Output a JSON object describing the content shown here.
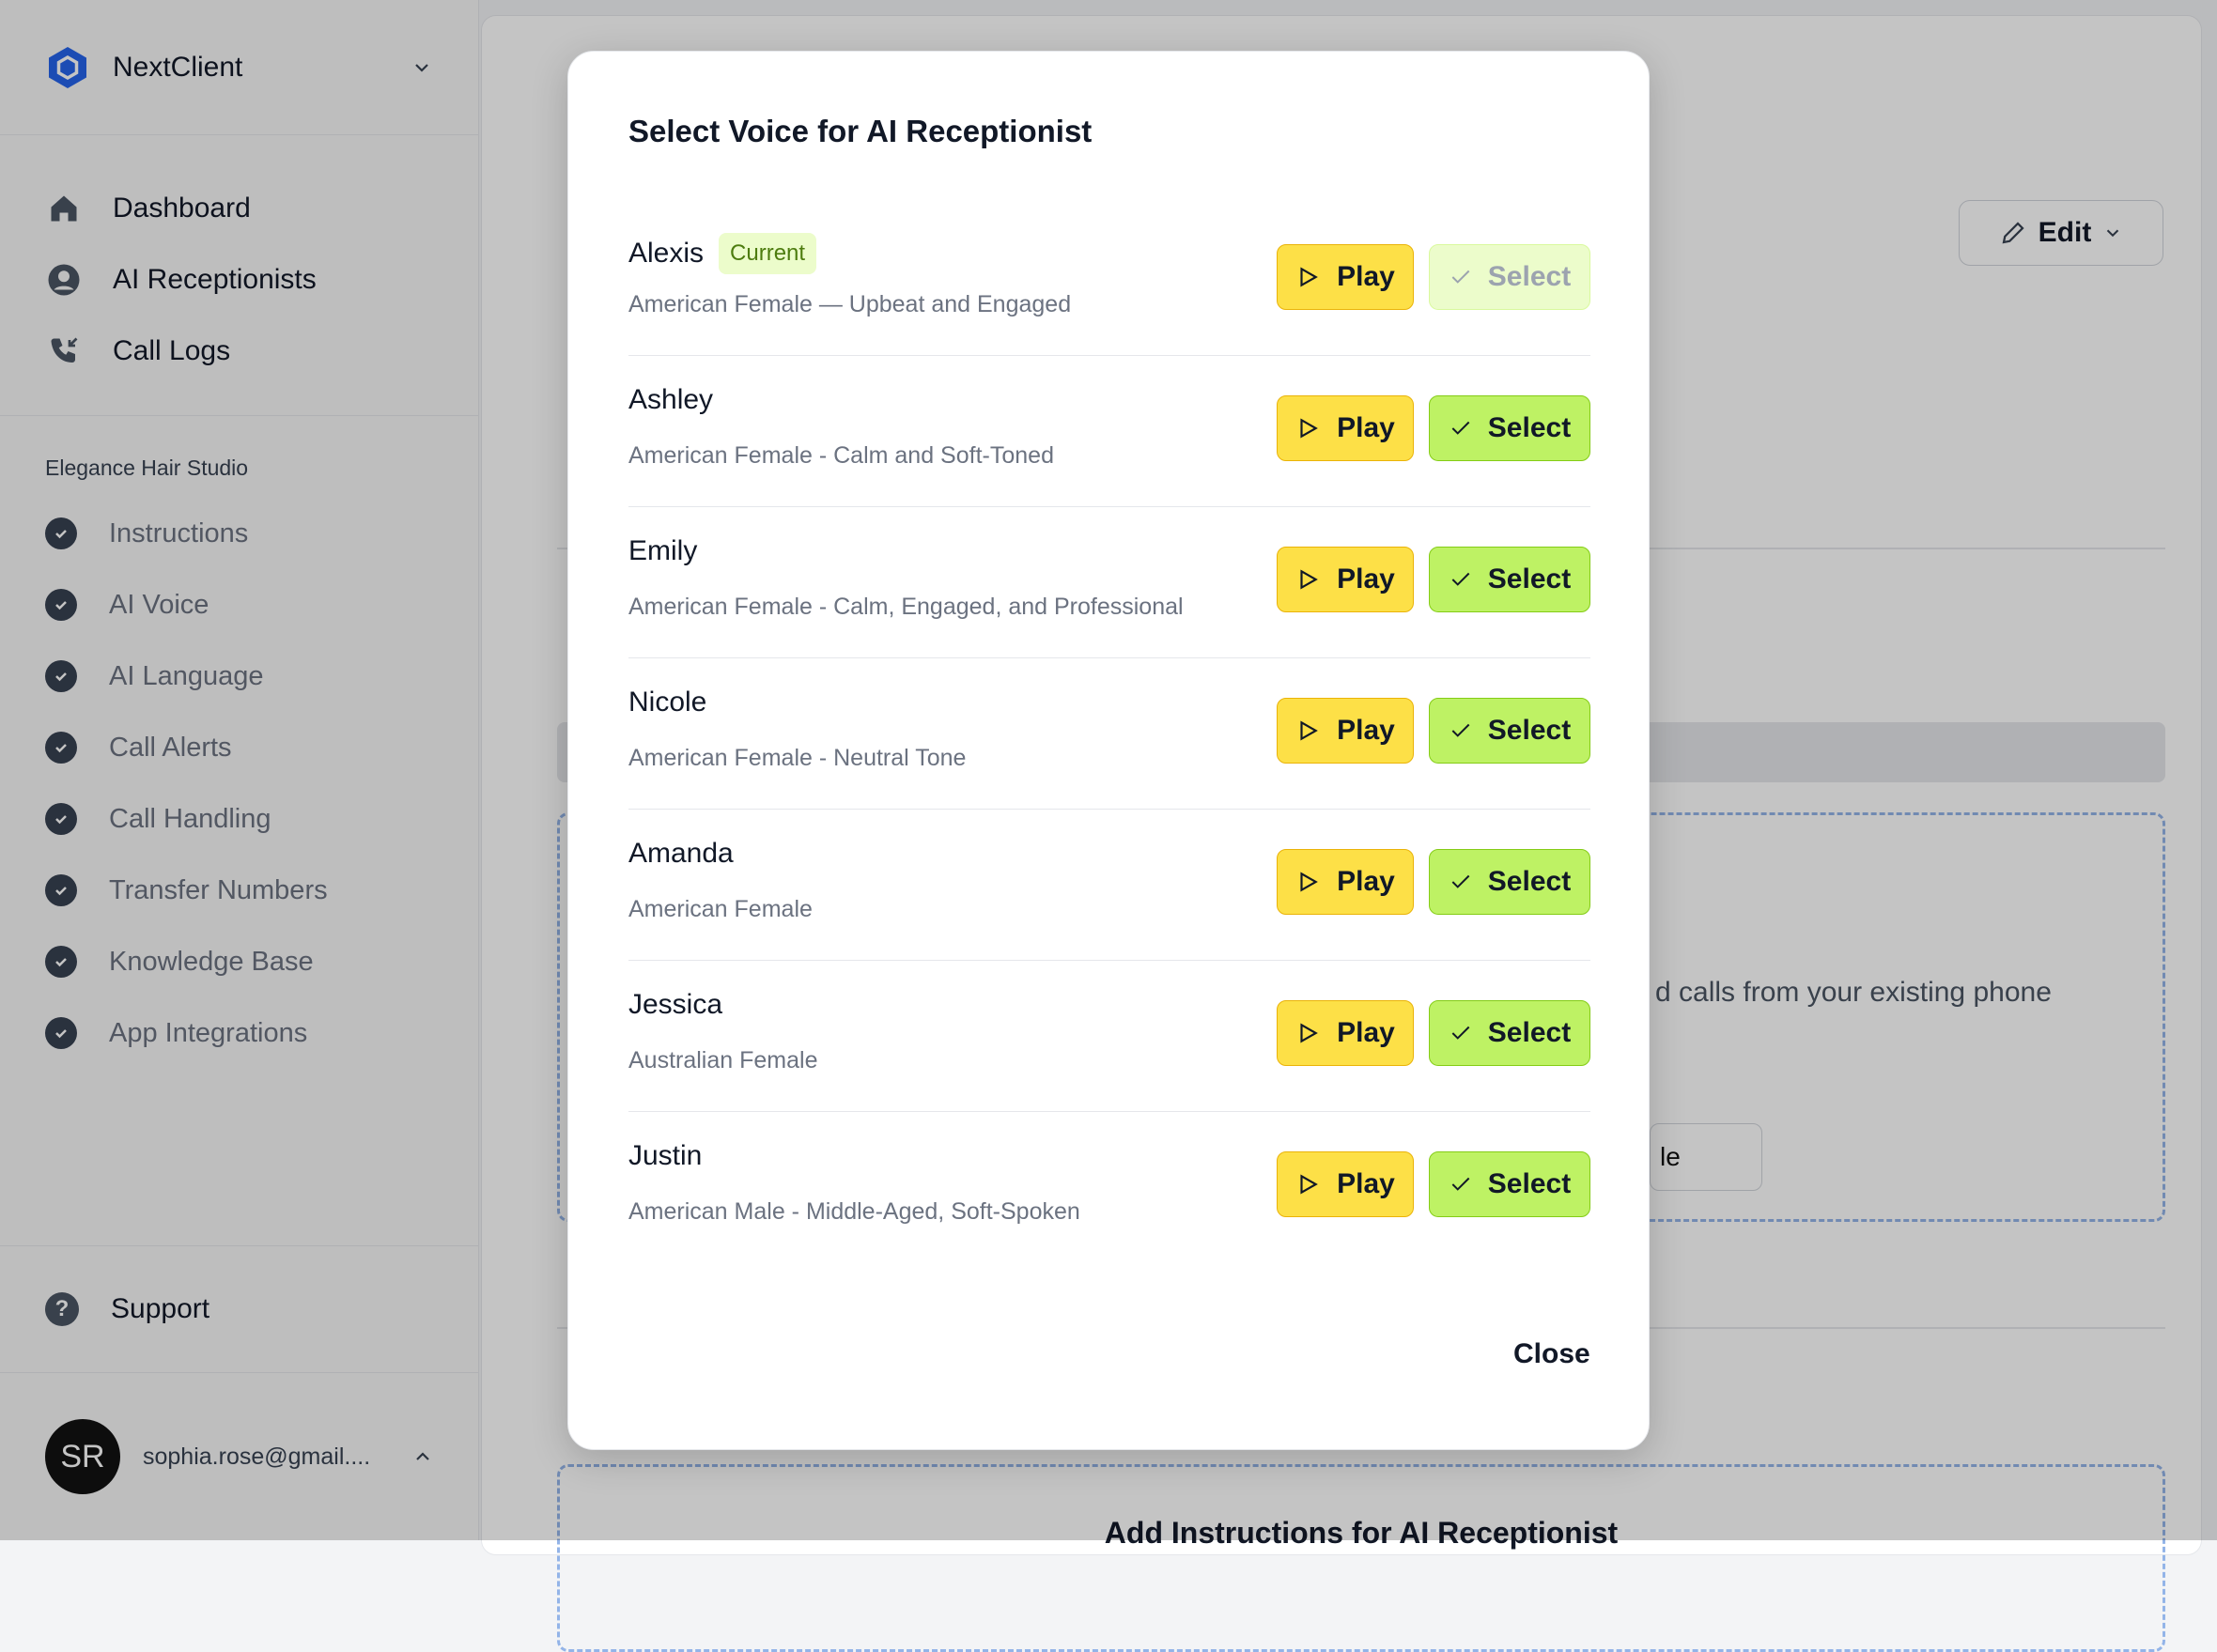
{
  "sidebar": {
    "brand": "NextClient",
    "nav": [
      {
        "label": "Dashboard",
        "icon": "home-icon"
      },
      {
        "label": "AI Receptionists",
        "icon": "user-circle-icon"
      },
      {
        "label": "Call Logs",
        "icon": "phone-incoming-icon"
      }
    ],
    "section_title": "Elegance Hair Studio",
    "steps": [
      {
        "label": "Instructions"
      },
      {
        "label": "AI Voice"
      },
      {
        "label": "AI Language"
      },
      {
        "label": "Call Alerts"
      },
      {
        "label": "Call Handling"
      },
      {
        "label": "Transfer Numbers"
      },
      {
        "label": "Knowledge Base"
      },
      {
        "label": "App Integrations"
      }
    ],
    "support": "Support",
    "user": {
      "initials": "SR",
      "email": "sophia.rose@gmail...."
    }
  },
  "main": {
    "edit_label": "Edit",
    "partial_text": "d calls from your existing phone",
    "partial_button": "le",
    "add_instructions": "Add Instructions for AI Receptionist"
  },
  "modal": {
    "title": "Select Voice for AI Receptionist",
    "play_label": "Play",
    "select_label": "Select",
    "current_badge": "Current",
    "close_label": "Close",
    "voices": [
      {
        "name": "Alexis",
        "description": "American Female — Upbeat and Engaged",
        "current": true
      },
      {
        "name": "Ashley",
        "description": "American Female - Calm and Soft-Toned",
        "current": false
      },
      {
        "name": "Emily",
        "description": "American Female - Calm, Engaged, and Professional",
        "current": false
      },
      {
        "name": "Nicole",
        "description": "American Female - Neutral Tone",
        "current": false
      },
      {
        "name": "Amanda",
        "description": "American Female",
        "current": false
      },
      {
        "name": "Jessica",
        "description": "Australian Female",
        "current": false
      },
      {
        "name": "Justin",
        "description": "American Male - Middle-Aged, Soft-Spoken",
        "current": false
      }
    ]
  },
  "colors": {
    "play": "#fde047",
    "select": "#bef264",
    "brand": "#2563eb"
  }
}
